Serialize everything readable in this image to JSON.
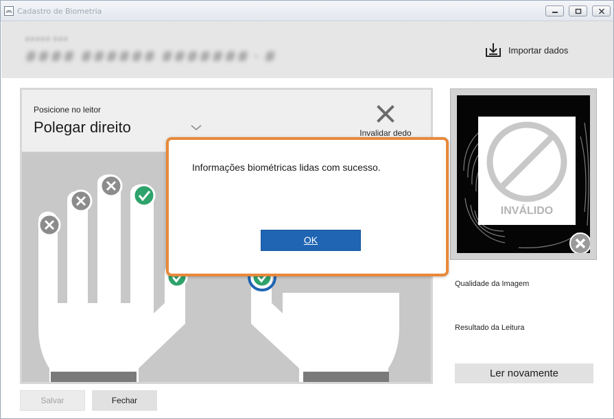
{
  "window": {
    "title": "Cadastro de Biometria",
    "buttons": [
      "minimize",
      "maximize",
      "close"
    ]
  },
  "header": {
    "patient_small": "##### ###",
    "patient_name": "#### ###### ####### · #",
    "import_label": "Importar dados"
  },
  "finger_panel": {
    "position_label": "Posicione no leitor",
    "finger_name": "Polegar direito",
    "invalidate_label": "Invalidar dedo"
  },
  "preview": {
    "status_text": "INVÁLIDO"
  },
  "right": {
    "quality_label": "Qualidade da Imagem",
    "result_label": "Resultado da Leitura",
    "reread_label": "Ler novamente"
  },
  "footer": {
    "save_label": "Salvar",
    "close_label": "Fechar"
  },
  "dialog": {
    "message": "Informações biométricas lidas com sucesso.",
    "ok_label": "OK"
  },
  "colors": {
    "accent_orange": "#e8893a",
    "primary_blue": "#1f65b3",
    "success_green": "#2ea36b",
    "invalid_gray": "#8c8c8c"
  }
}
